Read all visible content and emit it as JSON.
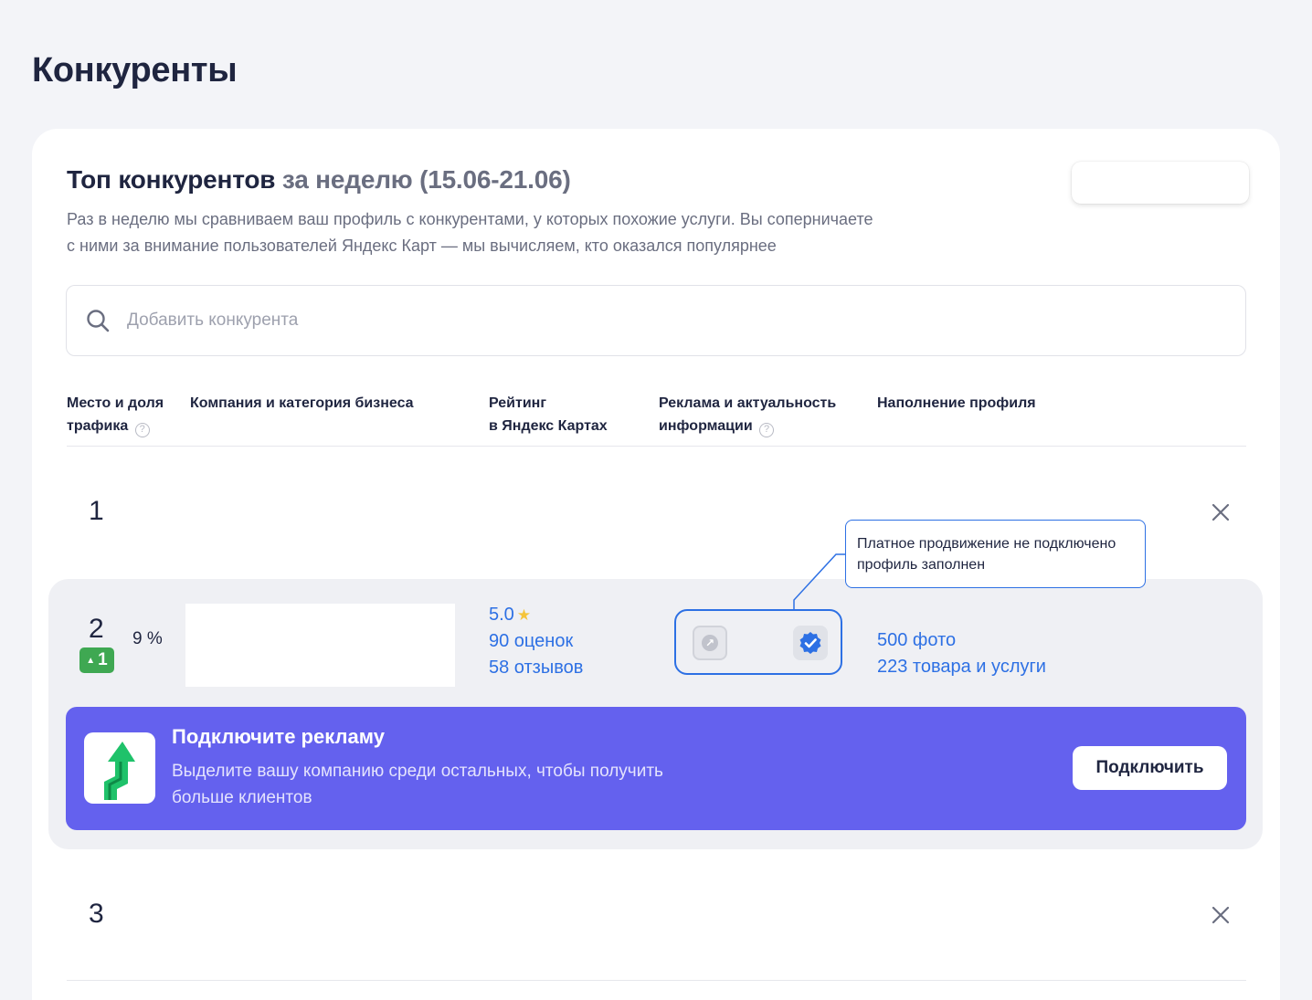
{
  "page": {
    "title": "Конкуренты"
  },
  "card": {
    "title_main": "Топ конкурентов",
    "title_sub": "за неделю (15.06-21.06)",
    "description_line1": "Раз в неделю мы сравниваем ваш профиль с конкурентами, у которых похожие услуги. Вы соперничаете",
    "description_line2": "с ними за внимание пользователей Яндекс Карт — мы вычисляем, кто оказался популярнее"
  },
  "search": {
    "placeholder": "Добавить конкурента",
    "value": ""
  },
  "table": {
    "headers": {
      "place_line1": "Место и доля",
      "place_line2": "трафика",
      "company": "Компания и категория бизнеса",
      "rating_line1": "Рейтинг",
      "rating_line2": "в Яндекс Картах",
      "ads_line1": "Реклама и актуальность",
      "ads_line2": "информации",
      "profile": "Наполнение профиля"
    },
    "help_glyph": "?",
    "rows": [
      {
        "rank": "1"
      },
      {
        "rank": "2",
        "change": "1",
        "share": "9 %",
        "rating": "5.0",
        "ratings_count": "90 оценок",
        "reviews_count": "58 отзывов",
        "photos": "500 фото",
        "products": "223 товара и услуги"
      },
      {
        "rank": "3"
      }
    ]
  },
  "tooltip": {
    "line1": "Платное продвижение не подключено",
    "line2": "профиль заполнен"
  },
  "promo": {
    "title": "Подключите рекламу",
    "text_line1": "Выделите вашу компанию среди остальных, чтобы получить",
    "text_line2": "больше клиентов",
    "button_label": "Подключить"
  },
  "colors": {
    "accent_blue": "#2d70e4",
    "promo_purple": "#6461ee",
    "growth_green": "#3fa852",
    "star_yellow": "#f5c43a"
  }
}
